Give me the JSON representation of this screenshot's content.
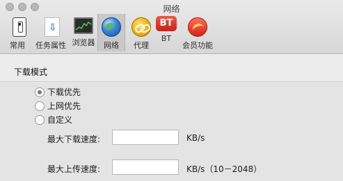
{
  "window": {
    "title": "网络"
  },
  "toolbar": {
    "items": [
      {
        "label": "常用",
        "icon": "general-switch-icon"
      },
      {
        "label": "任务属性",
        "icon": "download-doc-icon"
      },
      {
        "label": "浏览器",
        "icon": "browser-monitor-icon"
      },
      {
        "label": "网络",
        "icon": "network-globe-icon",
        "selected": true
      },
      {
        "label": "代理",
        "icon": "proxy-link-icon"
      },
      {
        "label": "BT",
        "icon": "bt-icon",
        "badge": "BT"
      },
      {
        "label": "会员功能",
        "icon": "vip-icon"
      }
    ]
  },
  "download_mode": {
    "title": "下载模式",
    "options": [
      {
        "label": "下载优先",
        "checked": true
      },
      {
        "label": "上网优先",
        "checked": false
      },
      {
        "label": "自定义",
        "checked": false
      }
    ],
    "max_download": {
      "label": "最大下载速度:",
      "value": "",
      "unit": "KB/s"
    },
    "max_upload": {
      "label": "最大上传速度:",
      "value": "",
      "unit": "KB/s（10－2048）"
    }
  },
  "colors": {
    "bt_red": "#d0332a",
    "globe_blue": "#2f7fd6",
    "proxy_gold": "#e6a300"
  }
}
